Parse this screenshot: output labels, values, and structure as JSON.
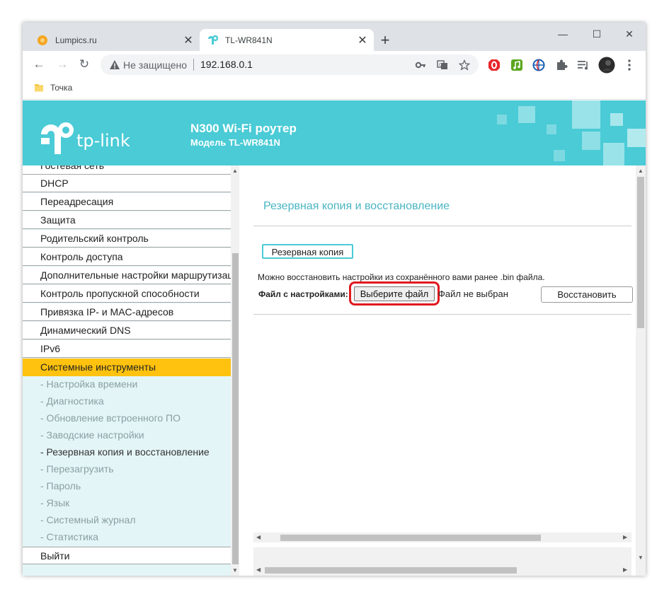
{
  "browser": {
    "tabs": [
      {
        "title": "Lumpics.ru",
        "close": "✕"
      },
      {
        "title": "TL-WR841N",
        "close": "✕"
      }
    ],
    "new_tab": "+",
    "window_controls": {
      "minimize": "—",
      "maximize": "☐",
      "close": "✕"
    },
    "nav": {
      "back": "←",
      "forward": "→",
      "reload": "↻"
    },
    "omnibox": {
      "security_text": "Не защищено",
      "url": "192.168.0.1"
    },
    "bookmarks": [
      {
        "label": "Точка"
      }
    ],
    "icons": [
      "warning-icon",
      "key-icon",
      "translate-icon",
      "star-icon",
      "opera-extension-icon",
      "music-extension-icon",
      "vpn-extension-icon",
      "puzzle-icon",
      "media-queue-icon",
      "profile-avatar",
      "kebab-menu-icon"
    ],
    "colors": {
      "tabstrip": "#dee1e6",
      "omnibox": "#f1f3f4"
    }
  },
  "router": {
    "brand": "tp-link",
    "header_title": "N300 Wi-Fi роутер",
    "header_model": "Модель TL-WR841N",
    "colors": {
      "header": "#4acbd6",
      "active_menu": "#ffc20e",
      "sidebar_bg": "#e4f5f7",
      "title": "#4ab5c2",
      "highlight": "#e0181f"
    },
    "sidebar": {
      "menu_top": [
        "Гостевая сеть",
        "DHCP",
        "Переадресация",
        "Защита",
        "Родительский контроль",
        "Контроль доступа",
        "Дополнительные настройки маршрутизации",
        "Контроль пропускной способности",
        "Привязка IP- и MAC-адресов",
        "Динамический DNS",
        "IPv6"
      ],
      "active": "Системные инструменты",
      "sub_items": [
        "- Настройка времени",
        "- Диагностика",
        "- Обновление встроенного ПО",
        "- Заводские настройки",
        "- Резервная копия и восстановление",
        "- Перезагрузить",
        "- Пароль",
        "- Язык",
        "- Системный журнал",
        "- Статистика"
      ],
      "current_sub": "- Резервная копия и восстановление",
      "logout": "Выйти"
    },
    "content": {
      "title": "Резервная копия и восстановление",
      "backup_button": "Резервная копия",
      "restore_note": "Можно восстановить настройки из сохранённого вами ранее .bin файла.",
      "file_label": "Файл с настройками:",
      "choose_file_button": "Выберите файл",
      "no_file_text": "Файл не выбран",
      "restore_button": "Восстановить"
    }
  }
}
